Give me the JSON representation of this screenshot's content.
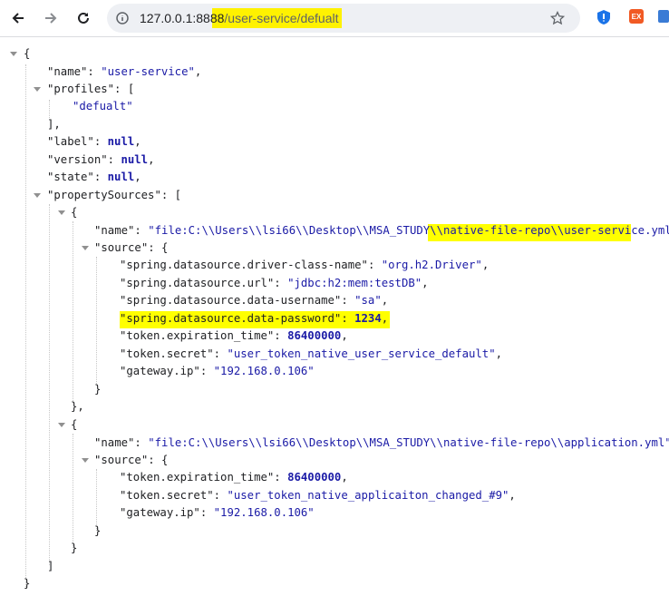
{
  "browser": {
    "url_host": "127.0.0.1:8888",
    "url_path": "/user-service/defualt",
    "icons": [
      "back-arrow-icon",
      "forward-arrow-icon",
      "reload-icon",
      "site-info-icon",
      "star-icon",
      "shield-extension-icon",
      "ex-extension-icon"
    ],
    "ext_ex_label": "EX"
  },
  "json": {
    "open_root": "{",
    "name_key": "\"name\"",
    "name_val": "\"user-service\"",
    "profiles_key": "\"profiles\"",
    "profiles_open": "[",
    "profile_0": "\"defualt\"",
    "profiles_close": "],",
    "label_key": "\"label\"",
    "version_key": "\"version\"",
    "state_key": "\"state\"",
    "null_val": "null",
    "ps_key": "\"propertySources\"",
    "ps_open": "[",
    "src0": {
      "open": "{",
      "name_key": "\"name\"",
      "name_prefix": "\"file:C:\\\\Users\\\\lsi66\\\\Desktop\\\\MSA_STUDY\\\\",
      "name_highlight": "native-file-repo\\\\user-service.yml",
      "name_suffix": "\",",
      "source_key": "\"source\"",
      "source_open": "{",
      "props": [
        {
          "k": "\"spring.datasource.driver-class-name\"",
          "v": "\"org.h2.Driver\"",
          "num": false,
          "comma": ","
        },
        {
          "k": "\"spring.datasource.url\"",
          "v": "\"jdbc:h2:mem:testDB\"",
          "num": false,
          "comma": ","
        },
        {
          "k": "\"spring.datasource.data-username\"",
          "v": "\"sa\"",
          "num": false,
          "comma": ","
        },
        {
          "k": "\"spring.datasource.data-password\"",
          "v": "1234",
          "num": true,
          "comma": ","
        },
        {
          "k": "\"token.expiration_time\"",
          "v": "86400000",
          "num": true,
          "comma": ","
        },
        {
          "k": "\"token.secret\"",
          "v": "\"user_token_native_user_service_default\"",
          "num": false,
          "comma": ","
        },
        {
          "k": "\"gateway.ip\"",
          "v": "\"192.168.0.106\"",
          "num": false,
          "comma": ""
        }
      ],
      "source_close": "}",
      "close": "},"
    },
    "src1": {
      "open": "{",
      "name_key": "\"name\"",
      "name_val": "\"file:C:\\\\Users\\\\lsi66\\\\Desktop\\\\MSA_STUDY\\\\native-file-repo\\\\application.yml\",",
      "source_key": "\"source\"",
      "source_open": "{",
      "props": [
        {
          "k": "\"token.expiration_time\"",
          "v": "86400000",
          "num": true,
          "comma": ","
        },
        {
          "k": "\"token.secret\"",
          "v": "\"user_token_native_applicaiton_changed_#9\"",
          "num": false,
          "comma": ","
        },
        {
          "k": "\"gateway.ip\"",
          "v": "\"192.168.0.106\"",
          "num": false,
          "comma": ""
        }
      ],
      "source_close": "}",
      "close": "}"
    },
    "ps_close": "]",
    "close_root": "}"
  }
}
